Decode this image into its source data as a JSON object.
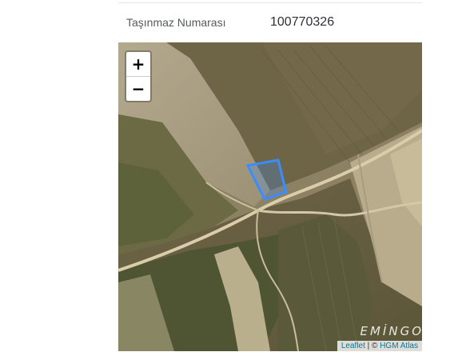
{
  "info": {
    "label": "Taşınmaz Numarası",
    "value": "100770326"
  },
  "map": {
    "zoom_in_label": "+",
    "zoom_out_label": "−",
    "parcel_color": "#3b8dff",
    "watermark": "EMİNGO",
    "attribution": {
      "leaflet": "Leaflet",
      "separator": " | © ",
      "provider": "HGM Atlas"
    }
  }
}
